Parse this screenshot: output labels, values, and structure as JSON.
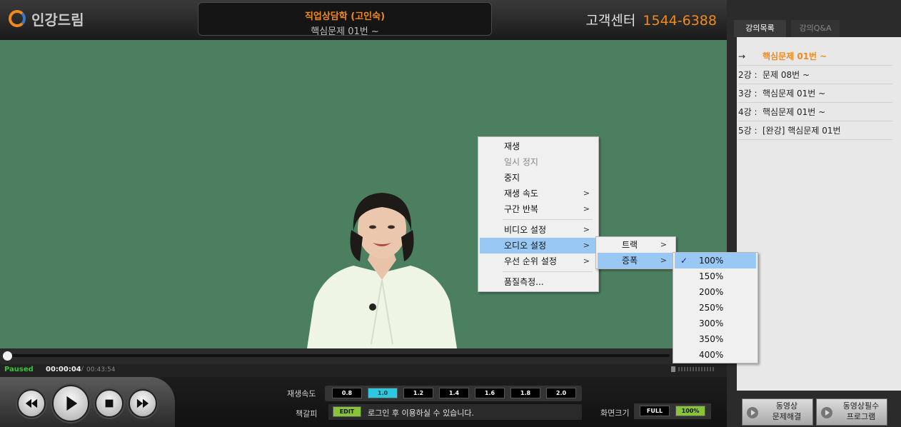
{
  "header": {
    "logo_text": "인강드림",
    "course_title": "직업상담학 (고인숙)",
    "lecture_title": "핵심문제 01번 ~",
    "cs_label": "고객센터",
    "cs_phone": "1544-6388"
  },
  "player": {
    "status": "Paused",
    "current_time": "00:00:04",
    "separator": "/",
    "total_time": "00:43:54",
    "progress_fraction": 0.0015
  },
  "controls": {
    "speed_label": "재생속도",
    "speeds": [
      "0.8",
      "1.0",
      "1.2",
      "1.4",
      "1.6",
      "1.8",
      "2.0"
    ],
    "active_speed": "1.0",
    "bookmark_label": "책갈피",
    "edit_label": "EDIT",
    "bookmark_text": "로그인 후 이용하실 수 있습니다.",
    "screen_label": "화면크기",
    "full_label": "FULL",
    "size_label": "100%"
  },
  "context_menu": {
    "items": [
      "재생",
      "일시 정지",
      "중지",
      "재생 속도",
      "구간 반복",
      "비디오 설정",
      "오디오 설정",
      "우선 순위 설정",
      "품질측정..."
    ],
    "disabled": [
      "일시 정지"
    ],
    "highlighted": "오디오 설정",
    "submenu_arrow": ">"
  },
  "audio_submenu": {
    "items": [
      "트랙",
      "증폭"
    ],
    "highlighted": "증폭"
  },
  "amplify_submenu": {
    "items": [
      "100%",
      "150%",
      "200%",
      "250%",
      "300%",
      "350%",
      "400%"
    ],
    "checked": "100%",
    "check_mark": "✓"
  },
  "sidebar": {
    "tabs": [
      "강의목록",
      "강의Q&A"
    ],
    "active_tab": "강의목록",
    "lectures": [
      {
        "no": "→",
        "title": "핵심문제 01번 ~"
      },
      {
        "no": "2강 :",
        "title": "문제 08번 ~"
      },
      {
        "no": "3강 :",
        "title": "핵심문제 01번 ~"
      },
      {
        "no": "4강 :",
        "title": "핵심문제 01번 ~"
      },
      {
        "no": "5강 :",
        "title": "[완강] 핵심문제 01번"
      }
    ],
    "bottom_buttons": [
      {
        "line1": "동영상",
        "line2": "문제해결"
      },
      {
        "line1": "동영상필수",
        "line2": "프로그램"
      }
    ]
  },
  "colors": {
    "accent": "#f08a1c",
    "board": "#4c7f60",
    "paused": "#39c339",
    "menu_highlight": "#9ac8f5",
    "active_speed": "#2ec7e0",
    "edit": "#88c43a"
  }
}
